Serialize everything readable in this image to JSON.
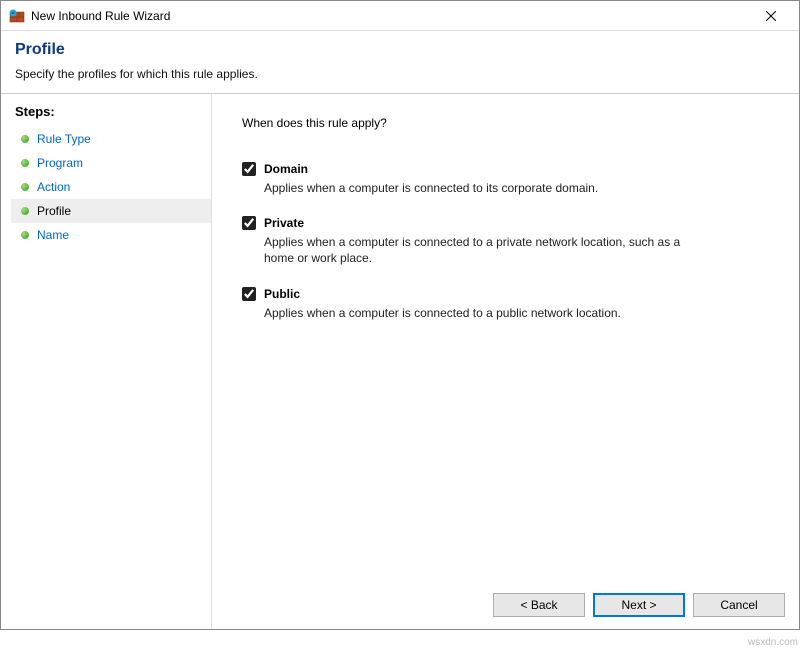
{
  "titlebar": {
    "title": "New Inbound Rule Wizard"
  },
  "header": {
    "title": "Profile",
    "subtitle": "Specify the profiles for which this rule applies."
  },
  "sidebar": {
    "heading": "Steps:",
    "items": [
      {
        "label": "Rule Type",
        "active": false
      },
      {
        "label": "Program",
        "active": false
      },
      {
        "label": "Action",
        "active": false
      },
      {
        "label": "Profile",
        "active": true
      },
      {
        "label": "Name",
        "active": false
      }
    ]
  },
  "content": {
    "prompt": "When does this rule apply?",
    "options": [
      {
        "name": "Domain",
        "desc": "Applies when a computer is connected to its corporate domain.",
        "checked": true
      },
      {
        "name": "Private",
        "desc": "Applies when a computer is connected to a private network location, such as a home or work place.",
        "checked": true
      },
      {
        "name": "Public",
        "desc": "Applies when a computer is connected to a public network location.",
        "checked": true
      }
    ]
  },
  "footer": {
    "back": "< Back",
    "next": "Next >",
    "cancel": "Cancel"
  },
  "watermark": "wsxdn.com"
}
